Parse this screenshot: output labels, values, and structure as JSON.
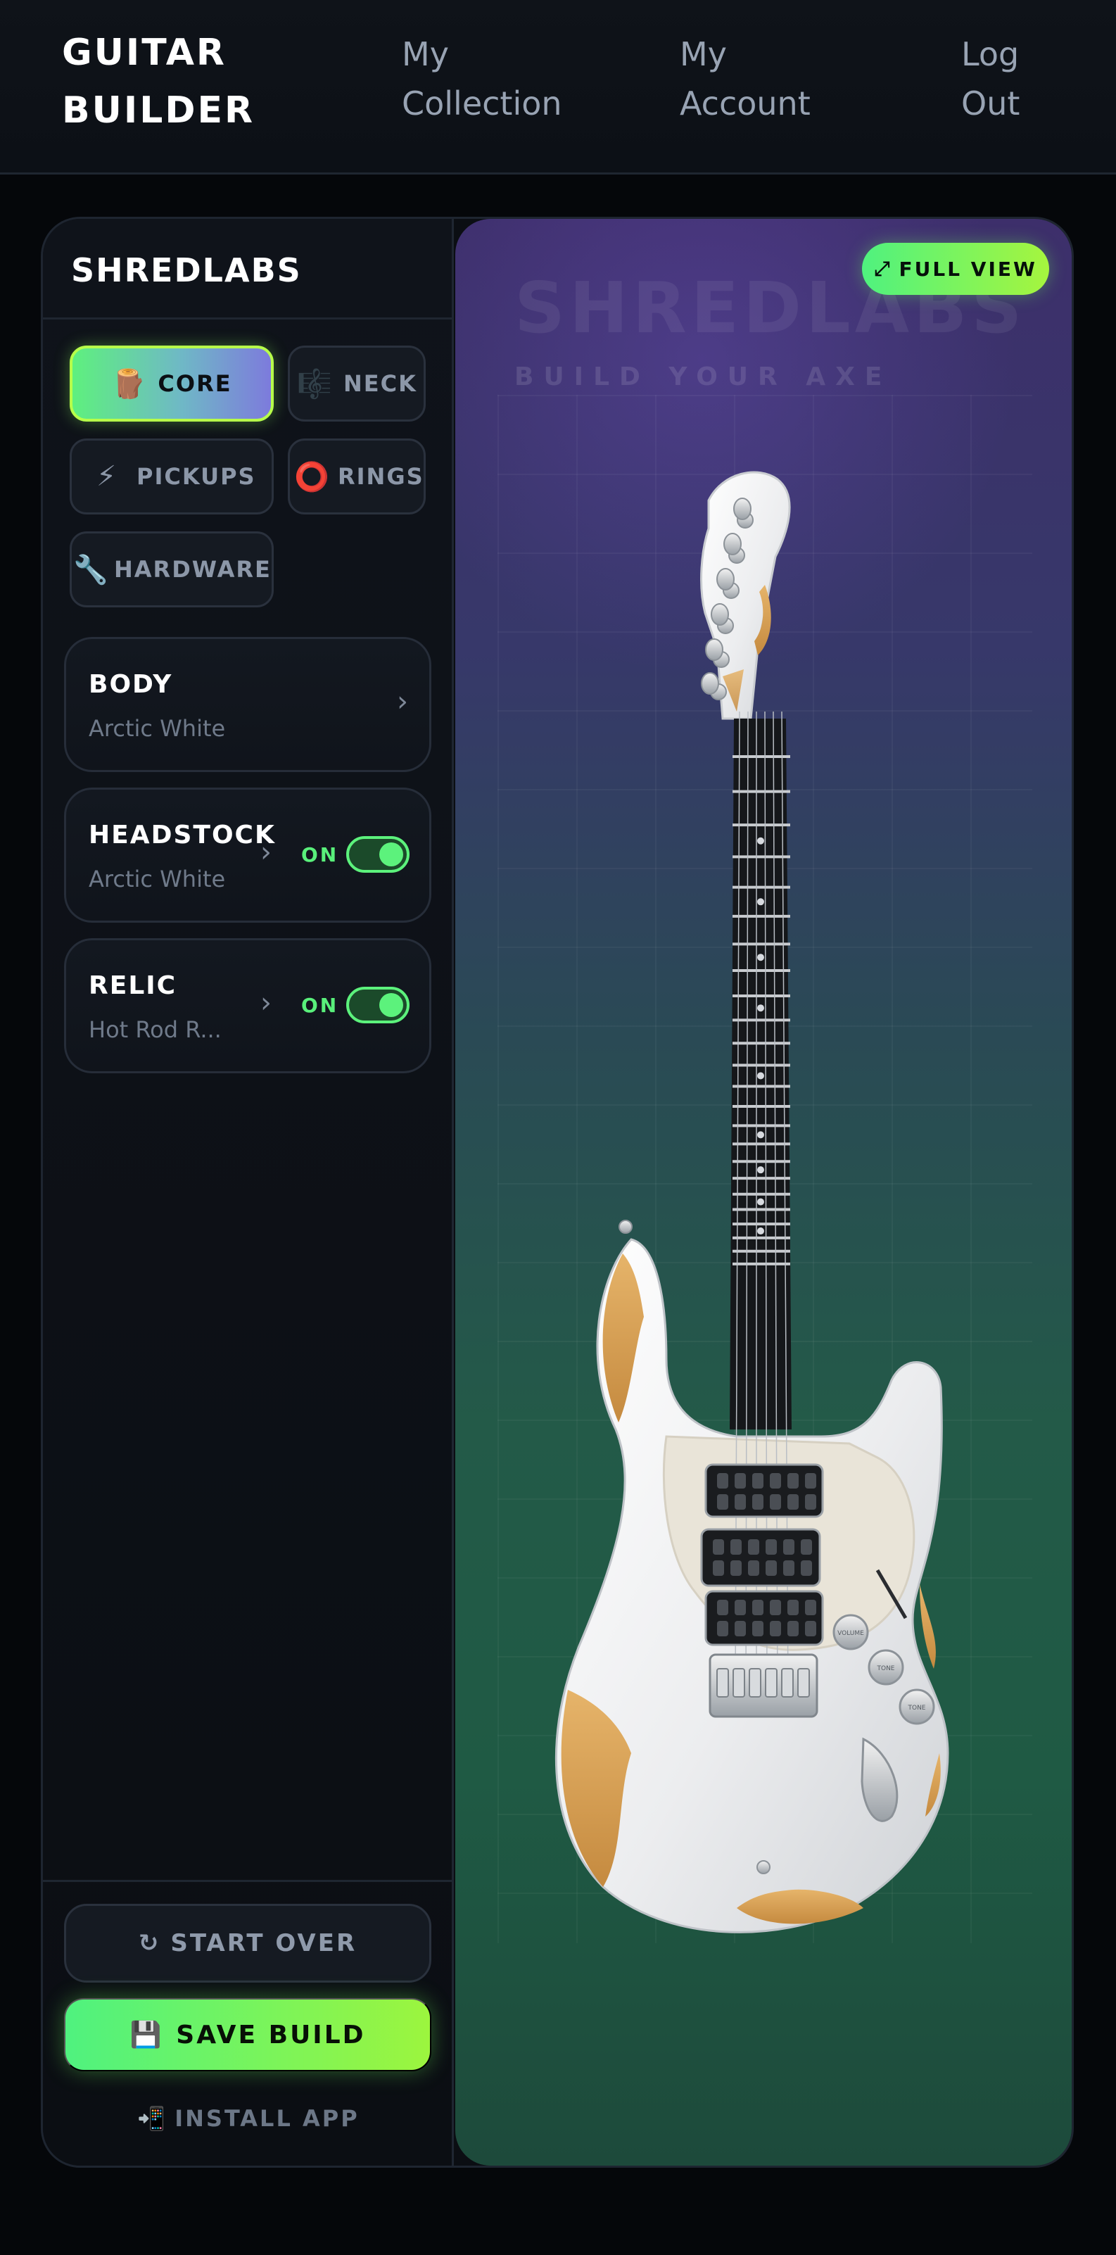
{
  "topnav": {
    "brand_line1": "GUITAR",
    "brand_line2": "BUILDER",
    "links": [
      {
        "line1": "My",
        "line2": "Collection"
      },
      {
        "line1": "My",
        "line2": "Account"
      },
      {
        "line1": "Log",
        "line2": "Out"
      }
    ]
  },
  "sidebar": {
    "title": "SHREDLABS",
    "tabs": [
      {
        "label": "CORE",
        "icon": "🪵",
        "icon_name": "wood-log-icon",
        "active": true
      },
      {
        "label": "NECK",
        "icon": "🎼",
        "icon_name": "music-staff-icon",
        "active": false
      },
      {
        "label": "PICKUPS",
        "icon": "⚡",
        "icon_name": "lightning-icon",
        "active": false
      },
      {
        "label": "RINGS",
        "icon": "⭕",
        "icon_name": "ring-icon",
        "active": false
      },
      {
        "label": "HARDWARE",
        "icon": "🔧",
        "icon_name": "wrench-icon",
        "active": false
      }
    ],
    "options": [
      {
        "title": "BODY",
        "value": "Arctic White",
        "toggle": null
      },
      {
        "title": "HEADSTOCK",
        "value": "Arctic White",
        "toggle": "ON"
      },
      {
        "title": "RELIC",
        "value": "Hot Rod R...",
        "toggle": "ON"
      }
    ],
    "chevron": "›",
    "start_over": {
      "icon": "↻",
      "label": "START OVER"
    },
    "save": {
      "icon": "💾",
      "label": "SAVE BUILD"
    },
    "install": {
      "icon": "📲",
      "label": "INSTALL APP"
    }
  },
  "preview": {
    "watermark_title": "SHREDLABS",
    "watermark_subtitle": "BUILD YOUR AXE",
    "fullview": {
      "icon": "⤢",
      "label": "FULL VIEW"
    },
    "knob_labels": [
      "VOLUME",
      "TONE",
      "TONE"
    ]
  },
  "colors": {
    "accent_green": "#5cf27c",
    "accent_lime": "#9cf53e",
    "body_white": "#eef0f2",
    "relic_wood": "#d7a25b"
  }
}
